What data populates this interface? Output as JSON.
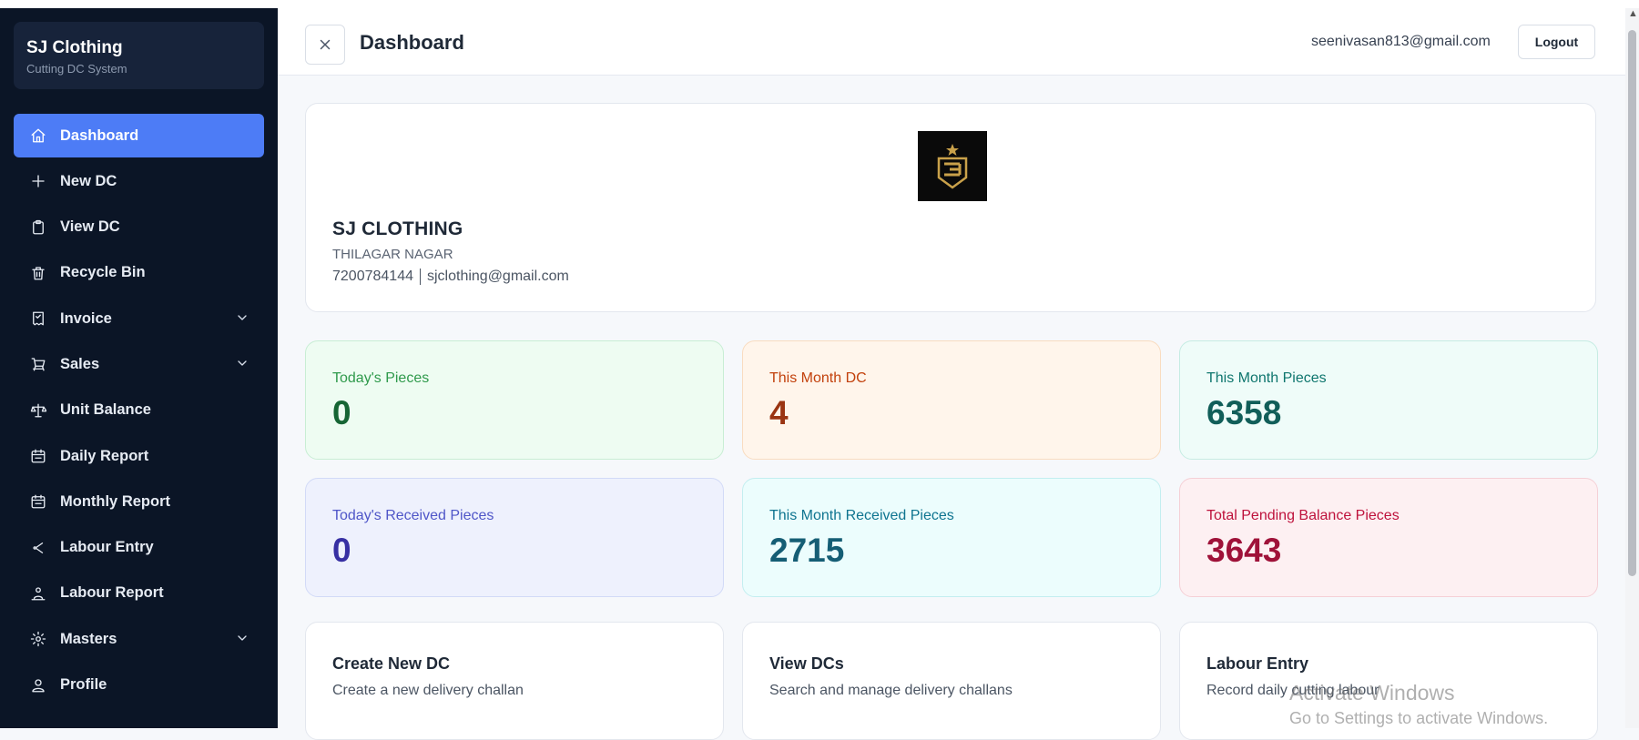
{
  "brand": {
    "title": "SJ Clothing",
    "subtitle": "Cutting DC System"
  },
  "sidebar": {
    "items": [
      {
        "label": "Dashboard",
        "icon": "home-icon",
        "active": true
      },
      {
        "label": "New DC",
        "icon": "plus-icon"
      },
      {
        "label": "View DC",
        "icon": "clipboard-icon"
      },
      {
        "label": "Recycle Bin",
        "icon": "trash-icon"
      },
      {
        "label": "Invoice",
        "icon": "receipt-icon",
        "expandable": true
      },
      {
        "label": "Sales",
        "icon": "cart-icon",
        "expandable": true
      },
      {
        "label": "Unit Balance",
        "icon": "scale-icon"
      },
      {
        "label": "Daily Report",
        "icon": "calendar-icon"
      },
      {
        "label": "Monthly Report",
        "icon": "calendar-icon"
      },
      {
        "label": "Labour Entry",
        "icon": "scissors-icon"
      },
      {
        "label": "Labour Report",
        "icon": "users-icon"
      },
      {
        "label": "Masters",
        "icon": "gear-icon",
        "expandable": true
      },
      {
        "label": "Profile",
        "icon": "user-icon"
      }
    ]
  },
  "header": {
    "title": "Dashboard",
    "user_email": "seenivasan813@gmail.com",
    "logout_label": "Logout"
  },
  "company": {
    "name": "SJ CLOTHING",
    "address": "THILAGAR NAGAR",
    "phone": "7200784144",
    "email": "sjclothing@gmail.com",
    "logo_icon": "company-logo-icon"
  },
  "stats": {
    "today_pieces": {
      "label": "Today's Pieces",
      "value": "0"
    },
    "month_dc": {
      "label": "This Month DC",
      "value": "4"
    },
    "month_pieces": {
      "label": "This Month Pieces",
      "value": "6358"
    },
    "today_received": {
      "label": "Today's Received Pieces",
      "value": "0"
    },
    "month_received": {
      "label": "This Month Received Pieces",
      "value": "2715"
    },
    "pending_balance": {
      "label": "Total Pending Balance Pieces",
      "value": "3643"
    }
  },
  "actions": {
    "create_dc": {
      "title": "Create New DC",
      "desc": "Create a new delivery challan"
    },
    "view_dcs": {
      "title": "View DCs",
      "desc": "Search and manage delivery challans"
    },
    "labour_entry": {
      "title": "Labour Entry",
      "desc": "Record daily cutting labour"
    }
  },
  "watermark": {
    "line1": "Activate Windows",
    "line2": "Go to Settings to activate Windows."
  },
  "colors": {
    "sidebar_bg": "#0b1526",
    "accent": "#4d7cf6",
    "brand_bg": "#17233a"
  }
}
